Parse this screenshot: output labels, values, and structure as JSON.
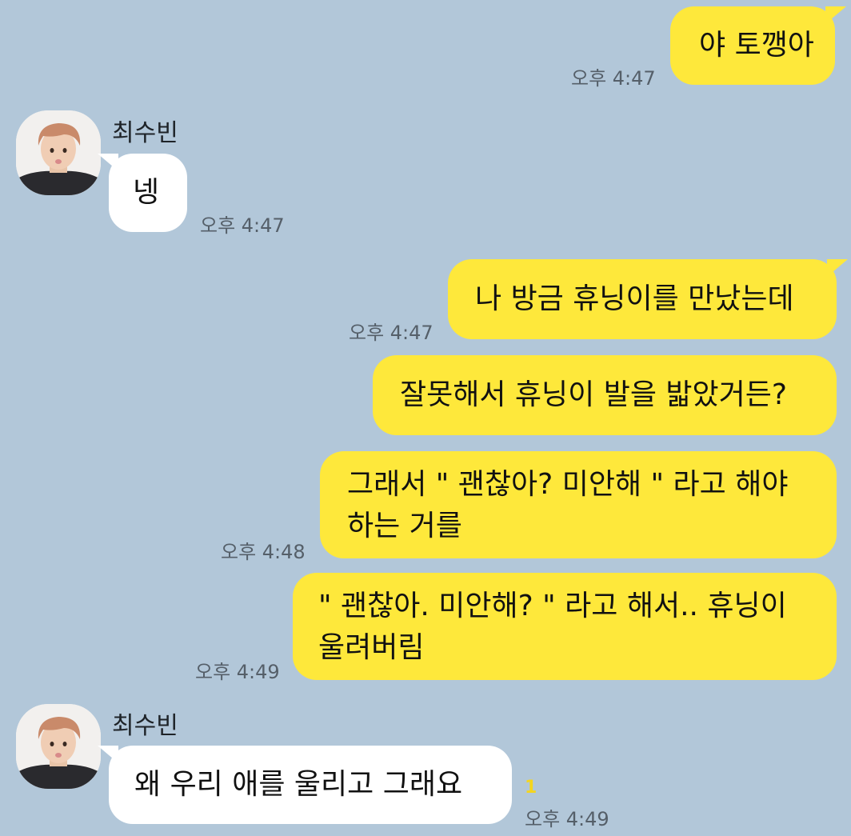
{
  "chat": {
    "sender_name": "최수빈",
    "messages": [
      {
        "text": "야 토깽아",
        "time": "오후 4:47"
      },
      {
        "text": "넹",
        "time": "오후 4:47"
      },
      {
        "text": "나 방금 휴닝이를 만났는데",
        "time": "오후 4:47"
      },
      {
        "text": "잘못해서 휴닝이 발을 밟았거든?"
      },
      {
        "line1": "그래서 \" 괜찮아? 미안해 \" 라고 해야",
        "line2": "하는 거를",
        "time": "오후 4:48"
      },
      {
        "line1": "\" 괜찮아. 미안해? \" 라고 해서.. 휴닝이",
        "line2": "울려버림",
        "time": "오후 4:49"
      },
      {
        "text": "왜 우리 애를 울리고 그래요",
        "time": "오후 4:49",
        "unread": "1"
      }
    ]
  },
  "colors": {
    "background": "#b2c7d9",
    "outgoing_bubble": "#fee83b",
    "incoming_bubble": "#ffffff"
  }
}
